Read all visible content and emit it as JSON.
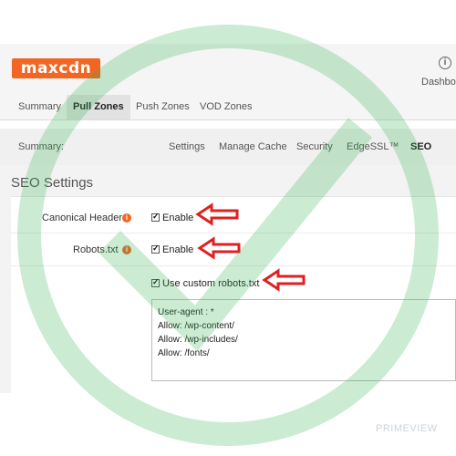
{
  "app": {
    "logo": "maxcdn"
  },
  "header": {
    "dashboard_label": "Dashbo",
    "dashboard_icon": "info-circle-icon"
  },
  "tabs": [
    {
      "label": "Summary",
      "active": false
    },
    {
      "label": "Pull Zones",
      "active": true
    },
    {
      "label": "Push Zones",
      "active": false
    },
    {
      "label": "VOD Zones",
      "active": false
    }
  ],
  "subnav": {
    "summary_label": "Summary:",
    "items": [
      {
        "label": "Settings",
        "active": false
      },
      {
        "label": "Manage Cache",
        "active": false
      },
      {
        "label": "Security",
        "active": false
      },
      {
        "label": "EdgeSSL™",
        "active": false
      },
      {
        "label": "SEO",
        "active": true
      }
    ]
  },
  "seo": {
    "title": "SEO Settings",
    "canonical": {
      "label": "Canonical Header",
      "checkbox_label": "Enable",
      "checked": true
    },
    "robots": {
      "label": "Robots.txt",
      "checkbox_label": "Enable",
      "checked": true
    },
    "custom_robots": {
      "checkbox_label": "Use custom robots.txt",
      "checked": true
    },
    "robots_content": [
      "User-agent : *",
      "Allow: /wp-content/",
      "Allow: /wp-includes/",
      "Allow: /fonts/"
    ]
  },
  "watermark": {
    "brand": "PRIMEVIEW"
  },
  "colors": {
    "accent": "#f26522",
    "arrow": "#e02020",
    "watermark": "#2eb24a"
  }
}
